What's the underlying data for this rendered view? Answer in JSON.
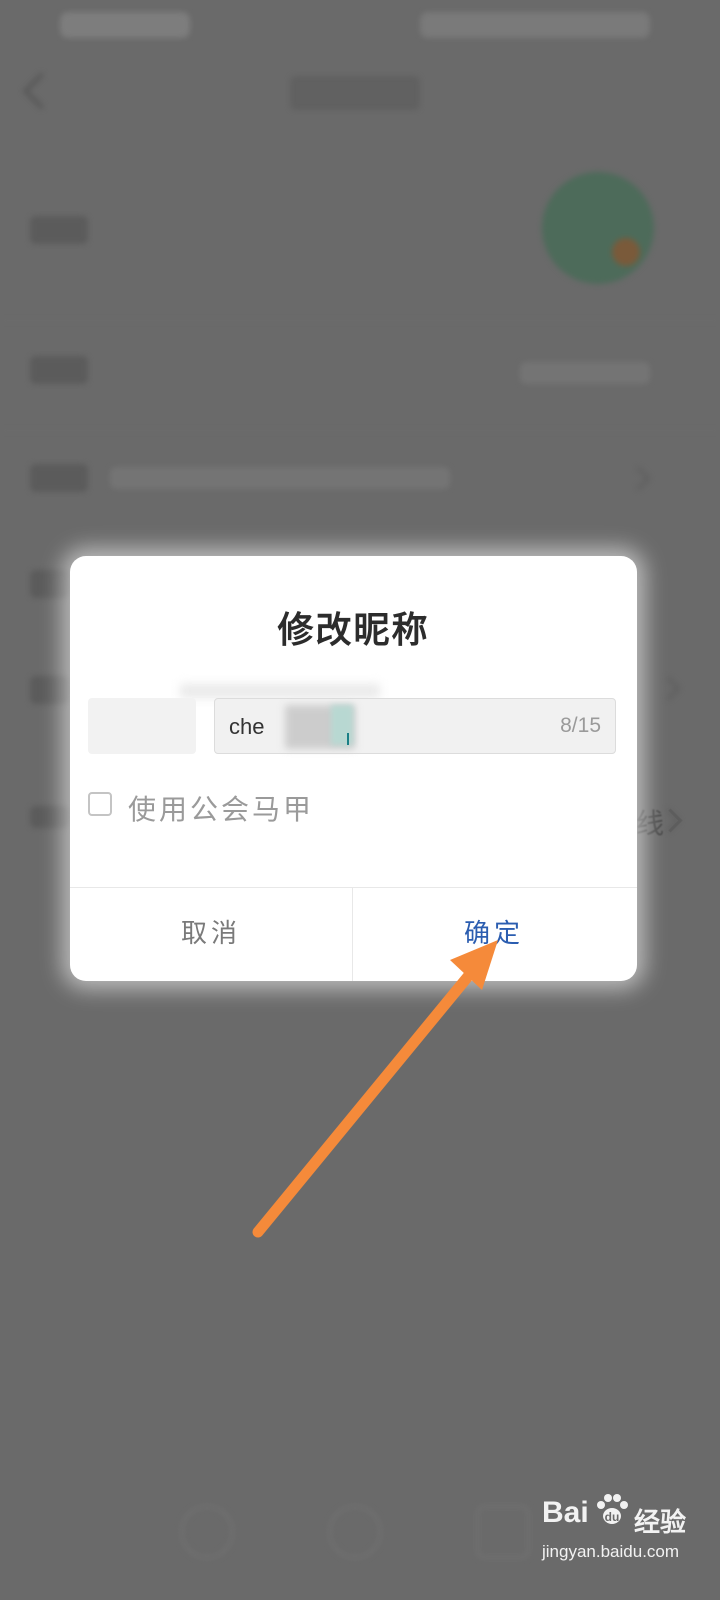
{
  "dialog": {
    "title": "修改昵称",
    "nickname_value": "che",
    "char_counter": "8/15",
    "checkbox_label": "使用公会马甲",
    "checkbox_checked": false,
    "cancel_label": "取消",
    "confirm_label": "确定"
  },
  "background": {
    "edge_char": "线"
  },
  "watermark": {
    "brand": "Bai",
    "brand_suffix": "经验",
    "url": "jingyan.baidu.com"
  },
  "colors": {
    "overlay": "#6a6a6a",
    "confirm_text": "#2b5db0",
    "annotation_arrow": "#f58a3a"
  }
}
